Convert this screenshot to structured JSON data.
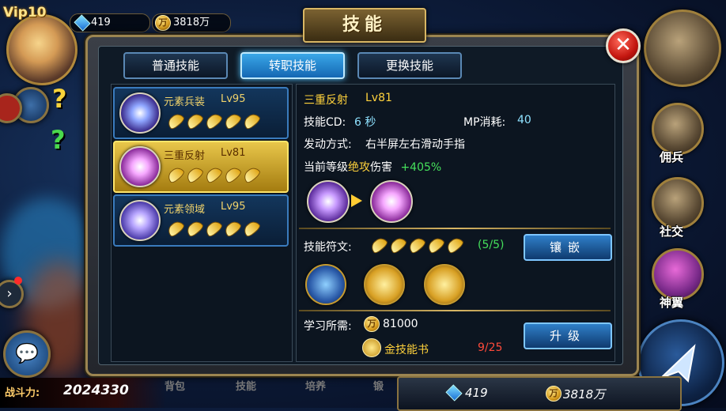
{
  "hud": {
    "vip": "Vip10",
    "gems": "419",
    "gold": "3818万"
  },
  "window": {
    "title": "技能",
    "close": "✕"
  },
  "tabs": [
    {
      "label": "普通技能",
      "active": false
    },
    {
      "label": "转职技能",
      "active": true
    },
    {
      "label": "更换技能",
      "active": false
    }
  ],
  "skills": [
    {
      "name": "元素兵装",
      "level": "Lv95",
      "feathers": 5,
      "selected": false
    },
    {
      "name": "三重反射",
      "level": "Lv81",
      "feathers": 5,
      "selected": true
    },
    {
      "name": "元素领域",
      "level": "Lv95",
      "feathers": 5,
      "selected": false
    }
  ],
  "detail": {
    "name": "三重反射",
    "level": "Lv81",
    "cd_label": "技能CD:",
    "cd_value": "6 秒",
    "mp_label": "MP消耗:",
    "mp_value": "40",
    "trigger_label": "发动方式:",
    "trigger_value": "右半屏左右滑动手指",
    "damage_prefix": "当前等级",
    "damage_highlight": "绝攻",
    "damage_suffix": "伤害",
    "damage_bonus": "+405%",
    "rune_label": "技能符文:",
    "rune_count": "(5/5)",
    "rune_feathers": 5,
    "inlay_button": "镶嵌",
    "learn_label": "学习所需:",
    "learn_cost": "81000",
    "book_name": "金技能书",
    "book_count": "9/25",
    "upgrade_button": "升级"
  },
  "right_menu": [
    {
      "label": "佣兵",
      "icon": "mercenary-icon"
    },
    {
      "label": "社交",
      "icon": "handshake-icon"
    },
    {
      "label": "神翼",
      "icon": "wings-icon"
    }
  ],
  "bottom": {
    "power_label": "战斗力:",
    "power_value": "2024330",
    "nav": [
      "背包",
      "技能",
      "培养",
      "锻"
    ],
    "gems": "419",
    "gold": "3818万"
  },
  "colors": {
    "accent_gold": "#ffd23c",
    "tab_active": "#3aa7e8",
    "bonus_green": "#45e05b",
    "counter_red": "#ff4a3a"
  }
}
